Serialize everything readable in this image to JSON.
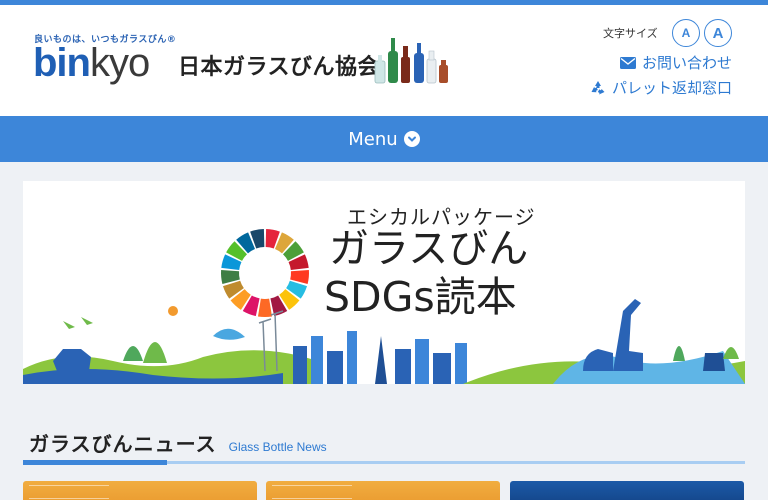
{
  "header": {
    "tagline": "良いものは、いつもガラスびん®",
    "logo_brand_bin": "bin",
    "logo_brand_kyo": "kyo",
    "org_name": "日本ガラスびん協会",
    "font_size_label": "文字サイズ",
    "font_small": "A",
    "font_large": "A",
    "contact_label": "お問い合わせ",
    "pallet_label": "パレット返却窓口"
  },
  "nav": {
    "menu_label": "Menu"
  },
  "banner": {
    "subtitle": "エシカルパッケージ",
    "title_line1": "ガラスびん",
    "title_line2": "SDGs読本"
  },
  "news": {
    "title": "ガラスびんニュース",
    "subtitle": "Glass Bottle News"
  },
  "colors": {
    "accent": "#3d86d9",
    "link": "#2e7ad1",
    "logo_blue": "#1f5fb5"
  }
}
